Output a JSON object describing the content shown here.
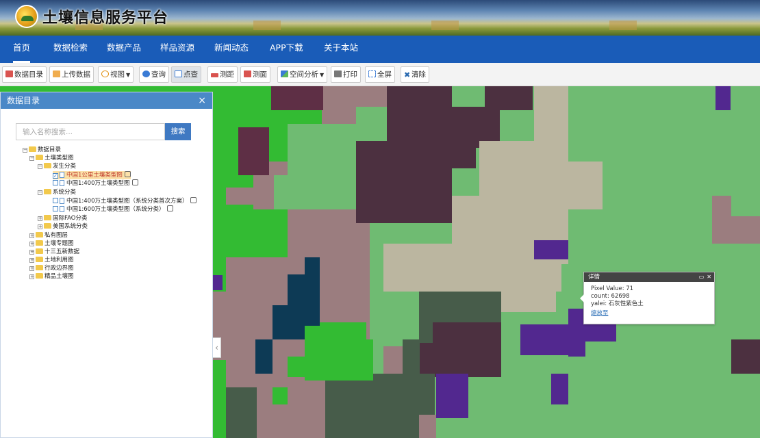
{
  "header": {
    "title": "土壤信息服务平台"
  },
  "nav": {
    "items": [
      {
        "label": "首页"
      },
      {
        "label": "数据检索"
      },
      {
        "label": "数据产品"
      },
      {
        "label": "样品资源"
      },
      {
        "label": "新闻动态"
      },
      {
        "label": "APP下载"
      },
      {
        "label": "关于本站"
      }
    ]
  },
  "toolbar": {
    "catalog": "数据目录",
    "upload": "上传数据",
    "view": "视图",
    "query": "查询",
    "point_query": "点查",
    "measure_distance": "测距",
    "measure_area": "测面",
    "spatial_analysis": "空间分析",
    "print": "打印",
    "fullscreen": "全屏",
    "clear": "清除"
  },
  "panel": {
    "title": "数据目录",
    "close": "×",
    "search_placeholder": "输入名称搜索...",
    "search_button": "搜索",
    "tree": {
      "root": "数据目录",
      "soil_type_map": "土壤类型图",
      "genetic": "发生分类",
      "leaf1": "中国1公里土壤类型图",
      "leaf2": "中国1:400万土壤类型图",
      "system": "系统分类",
      "leaf3": "中国1:400万土壤类型图（系统分类首次方案）",
      "leaf4": "中国1:600万土壤类型图（系统分类）",
      "fao": "国际FAO分类",
      "usa": "美国系统分类",
      "private": "私有图层",
      "thematic": "土壤专题图",
      "five_year": "十三五新数据",
      "landuse": "土地利用图",
      "boundary": "行政边界图",
      "premium": "精品土壤图"
    }
  },
  "popup": {
    "title": "详情",
    "pixel_value": "Pixel Value: 71",
    "count": "count: 62698",
    "yalei": "yalei: 石灰性紫色土",
    "zoom_link": "缩放至"
  },
  "colors": {
    "nav_bg": "#1a5cb8",
    "panel_header": "#4a88c7",
    "map_base": "#6fbb72"
  }
}
